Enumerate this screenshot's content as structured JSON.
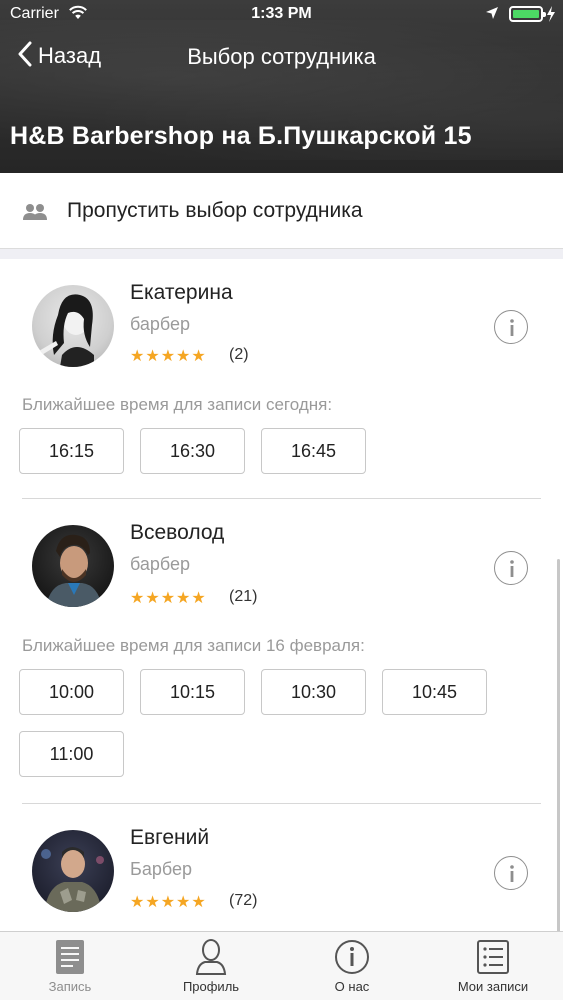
{
  "status_bar": {
    "carrier": "Carrier",
    "time": "1:33 PM"
  },
  "nav": {
    "back_label": "Назад",
    "title": "Выбор сотрудника"
  },
  "shop_title": "H&B Barbershop на Б.Пушкарской 15",
  "skip": {
    "label": "Пропустить выбор сотрудника",
    "icon": "people-icon"
  },
  "staff": [
    {
      "name": "Екатерина",
      "role": "барбер",
      "stars": "★★★★★",
      "reviews": "(2)",
      "nearest_label": "Ближайшее время для записи сегодня:",
      "slots": [
        "16:15",
        "16:30",
        "16:45"
      ]
    },
    {
      "name": "Всеволод",
      "role": "барбер",
      "stars": "★★★★★",
      "reviews": "(21)",
      "nearest_label": "Ближайшее время для записи 16 февраля:",
      "slots": [
        "10:00",
        "10:15",
        "10:30",
        "10:45",
        "11:00"
      ]
    },
    {
      "name": "Евгений",
      "role": "Барбер",
      "stars": "★★★★★",
      "reviews": "(72)"
    }
  ],
  "tabs": [
    {
      "label": "Запись",
      "icon": "booking-icon",
      "active": true
    },
    {
      "label": "Профиль",
      "icon": "profile-icon",
      "active": false
    },
    {
      "label": "О нас",
      "icon": "info-icon",
      "active": false
    },
    {
      "label": "Мои записи",
      "icon": "list-icon",
      "active": false
    }
  ],
  "colors": {
    "accent_star": "#f5a623",
    "header_bg": "#2e2e2e",
    "battery": "#4cd964"
  }
}
